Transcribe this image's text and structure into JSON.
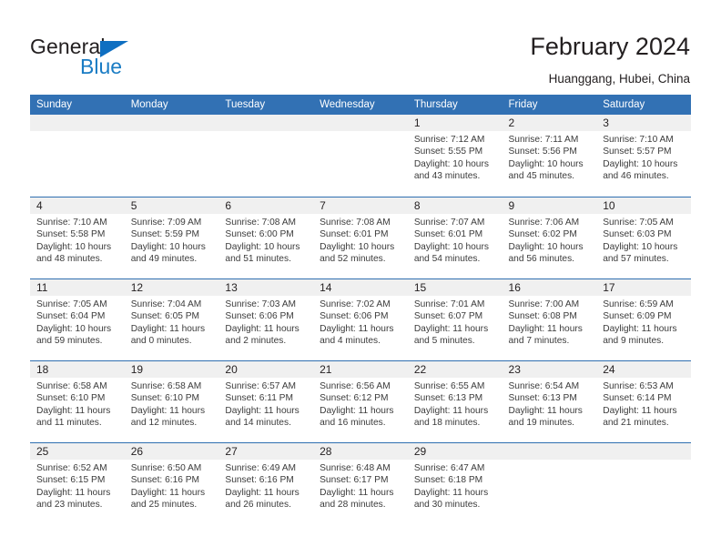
{
  "brand": {
    "name_part1": "General",
    "name_part2": "Blue",
    "logo_icon": "triangle-logo-icon",
    "accent_color": "#1a7cc4"
  },
  "header": {
    "title": "February 2024",
    "subtitle": "Huanggang, Hubei, China"
  },
  "calendar": {
    "header_background": "#3271b4",
    "daynum_background": "#f0f0f0",
    "row_separator_color": "#2f6fb0",
    "weekday_headers": [
      "Sunday",
      "Monday",
      "Tuesday",
      "Wednesday",
      "Thursday",
      "Friday",
      "Saturday"
    ],
    "weeks": [
      [
        {
          "day": "",
          "sunrise": "",
          "sunset": "",
          "daylight1": "",
          "daylight2": ""
        },
        {
          "day": "",
          "sunrise": "",
          "sunset": "",
          "daylight1": "",
          "daylight2": ""
        },
        {
          "day": "",
          "sunrise": "",
          "sunset": "",
          "daylight1": "",
          "daylight2": ""
        },
        {
          "day": "",
          "sunrise": "",
          "sunset": "",
          "daylight1": "",
          "daylight2": ""
        },
        {
          "day": "1",
          "sunrise": "Sunrise: 7:12 AM",
          "sunset": "Sunset: 5:55 PM",
          "daylight1": "Daylight: 10 hours",
          "daylight2": "and 43 minutes."
        },
        {
          "day": "2",
          "sunrise": "Sunrise: 7:11 AM",
          "sunset": "Sunset: 5:56 PM",
          "daylight1": "Daylight: 10 hours",
          "daylight2": "and 45 minutes."
        },
        {
          "day": "3",
          "sunrise": "Sunrise: 7:10 AM",
          "sunset": "Sunset: 5:57 PM",
          "daylight1": "Daylight: 10 hours",
          "daylight2": "and 46 minutes."
        }
      ],
      [
        {
          "day": "4",
          "sunrise": "Sunrise: 7:10 AM",
          "sunset": "Sunset: 5:58 PM",
          "daylight1": "Daylight: 10 hours",
          "daylight2": "and 48 minutes."
        },
        {
          "day": "5",
          "sunrise": "Sunrise: 7:09 AM",
          "sunset": "Sunset: 5:59 PM",
          "daylight1": "Daylight: 10 hours",
          "daylight2": "and 49 minutes."
        },
        {
          "day": "6",
          "sunrise": "Sunrise: 7:08 AM",
          "sunset": "Sunset: 6:00 PM",
          "daylight1": "Daylight: 10 hours",
          "daylight2": "and 51 minutes."
        },
        {
          "day": "7",
          "sunrise": "Sunrise: 7:08 AM",
          "sunset": "Sunset: 6:01 PM",
          "daylight1": "Daylight: 10 hours",
          "daylight2": "and 52 minutes."
        },
        {
          "day": "8",
          "sunrise": "Sunrise: 7:07 AM",
          "sunset": "Sunset: 6:01 PM",
          "daylight1": "Daylight: 10 hours",
          "daylight2": "and 54 minutes."
        },
        {
          "day": "9",
          "sunrise": "Sunrise: 7:06 AM",
          "sunset": "Sunset: 6:02 PM",
          "daylight1": "Daylight: 10 hours",
          "daylight2": "and 56 minutes."
        },
        {
          "day": "10",
          "sunrise": "Sunrise: 7:05 AM",
          "sunset": "Sunset: 6:03 PM",
          "daylight1": "Daylight: 10 hours",
          "daylight2": "and 57 minutes."
        }
      ],
      [
        {
          "day": "11",
          "sunrise": "Sunrise: 7:05 AM",
          "sunset": "Sunset: 6:04 PM",
          "daylight1": "Daylight: 10 hours",
          "daylight2": "and 59 minutes."
        },
        {
          "day": "12",
          "sunrise": "Sunrise: 7:04 AM",
          "sunset": "Sunset: 6:05 PM",
          "daylight1": "Daylight: 11 hours",
          "daylight2": "and 0 minutes."
        },
        {
          "day": "13",
          "sunrise": "Sunrise: 7:03 AM",
          "sunset": "Sunset: 6:06 PM",
          "daylight1": "Daylight: 11 hours",
          "daylight2": "and 2 minutes."
        },
        {
          "day": "14",
          "sunrise": "Sunrise: 7:02 AM",
          "sunset": "Sunset: 6:06 PM",
          "daylight1": "Daylight: 11 hours",
          "daylight2": "and 4 minutes."
        },
        {
          "day": "15",
          "sunrise": "Sunrise: 7:01 AM",
          "sunset": "Sunset: 6:07 PM",
          "daylight1": "Daylight: 11 hours",
          "daylight2": "and 5 minutes."
        },
        {
          "day": "16",
          "sunrise": "Sunrise: 7:00 AM",
          "sunset": "Sunset: 6:08 PM",
          "daylight1": "Daylight: 11 hours",
          "daylight2": "and 7 minutes."
        },
        {
          "day": "17",
          "sunrise": "Sunrise: 6:59 AM",
          "sunset": "Sunset: 6:09 PM",
          "daylight1": "Daylight: 11 hours",
          "daylight2": "and 9 minutes."
        }
      ],
      [
        {
          "day": "18",
          "sunrise": "Sunrise: 6:58 AM",
          "sunset": "Sunset: 6:10 PM",
          "daylight1": "Daylight: 11 hours",
          "daylight2": "and 11 minutes."
        },
        {
          "day": "19",
          "sunrise": "Sunrise: 6:58 AM",
          "sunset": "Sunset: 6:10 PM",
          "daylight1": "Daylight: 11 hours",
          "daylight2": "and 12 minutes."
        },
        {
          "day": "20",
          "sunrise": "Sunrise: 6:57 AM",
          "sunset": "Sunset: 6:11 PM",
          "daylight1": "Daylight: 11 hours",
          "daylight2": "and 14 minutes."
        },
        {
          "day": "21",
          "sunrise": "Sunrise: 6:56 AM",
          "sunset": "Sunset: 6:12 PM",
          "daylight1": "Daylight: 11 hours",
          "daylight2": "and 16 minutes."
        },
        {
          "day": "22",
          "sunrise": "Sunrise: 6:55 AM",
          "sunset": "Sunset: 6:13 PM",
          "daylight1": "Daylight: 11 hours",
          "daylight2": "and 18 minutes."
        },
        {
          "day": "23",
          "sunrise": "Sunrise: 6:54 AM",
          "sunset": "Sunset: 6:13 PM",
          "daylight1": "Daylight: 11 hours",
          "daylight2": "and 19 minutes."
        },
        {
          "day": "24",
          "sunrise": "Sunrise: 6:53 AM",
          "sunset": "Sunset: 6:14 PM",
          "daylight1": "Daylight: 11 hours",
          "daylight2": "and 21 minutes."
        }
      ],
      [
        {
          "day": "25",
          "sunrise": "Sunrise: 6:52 AM",
          "sunset": "Sunset: 6:15 PM",
          "daylight1": "Daylight: 11 hours",
          "daylight2": "and 23 minutes."
        },
        {
          "day": "26",
          "sunrise": "Sunrise: 6:50 AM",
          "sunset": "Sunset: 6:16 PM",
          "daylight1": "Daylight: 11 hours",
          "daylight2": "and 25 minutes."
        },
        {
          "day": "27",
          "sunrise": "Sunrise: 6:49 AM",
          "sunset": "Sunset: 6:16 PM",
          "daylight1": "Daylight: 11 hours",
          "daylight2": "and 26 minutes."
        },
        {
          "day": "28",
          "sunrise": "Sunrise: 6:48 AM",
          "sunset": "Sunset: 6:17 PM",
          "daylight1": "Daylight: 11 hours",
          "daylight2": "and 28 minutes."
        },
        {
          "day": "29",
          "sunrise": "Sunrise: 6:47 AM",
          "sunset": "Sunset: 6:18 PM",
          "daylight1": "Daylight: 11 hours",
          "daylight2": "and 30 minutes."
        },
        {
          "day": "",
          "sunrise": "",
          "sunset": "",
          "daylight1": "",
          "daylight2": ""
        },
        {
          "day": "",
          "sunrise": "",
          "sunset": "",
          "daylight1": "",
          "daylight2": ""
        }
      ]
    ]
  }
}
